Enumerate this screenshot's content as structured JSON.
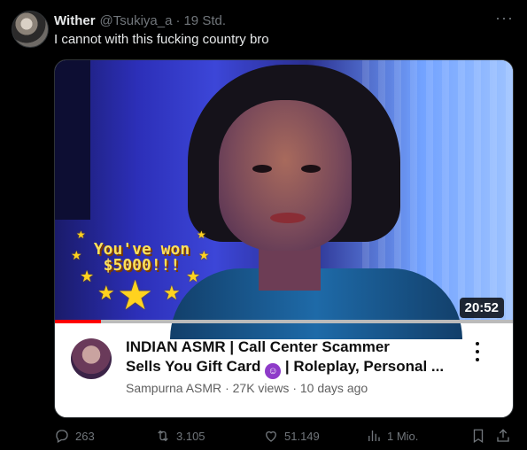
{
  "tweet": {
    "display_name": "Wither",
    "handle": "@Tsukiya_a",
    "separator": "·",
    "time": "19 Std.",
    "text": "I cannot with this fucking country bro",
    "more_label": "···"
  },
  "video": {
    "thumbnail_text": "You've won $5000!!!",
    "duration": "20:52",
    "progress_fraction": 0.1,
    "title_line1": "INDIAN ASMR | Call Center Scammer",
    "title_line2_before_emoji": "Sells You Gift Card",
    "title_line2_after_emoji": "| Roleplay, Personal ...",
    "channel": "Sampurna ASMR",
    "meta_separator": "·",
    "views": "27K views",
    "age": "10 days ago"
  },
  "actions": {
    "replies": "263",
    "reposts": "3.105",
    "likes": "51.149",
    "views": "1 Mio."
  },
  "icons": {
    "reply": "reply-icon",
    "repost": "repost-icon",
    "like": "heart-icon",
    "views": "views-bar-icon",
    "bookmark": "bookmark-icon",
    "share": "share-icon"
  },
  "colors": {
    "background": "#000000",
    "text": "#e7e9ea",
    "muted": "#71767b",
    "progress": "#ff0000"
  }
}
